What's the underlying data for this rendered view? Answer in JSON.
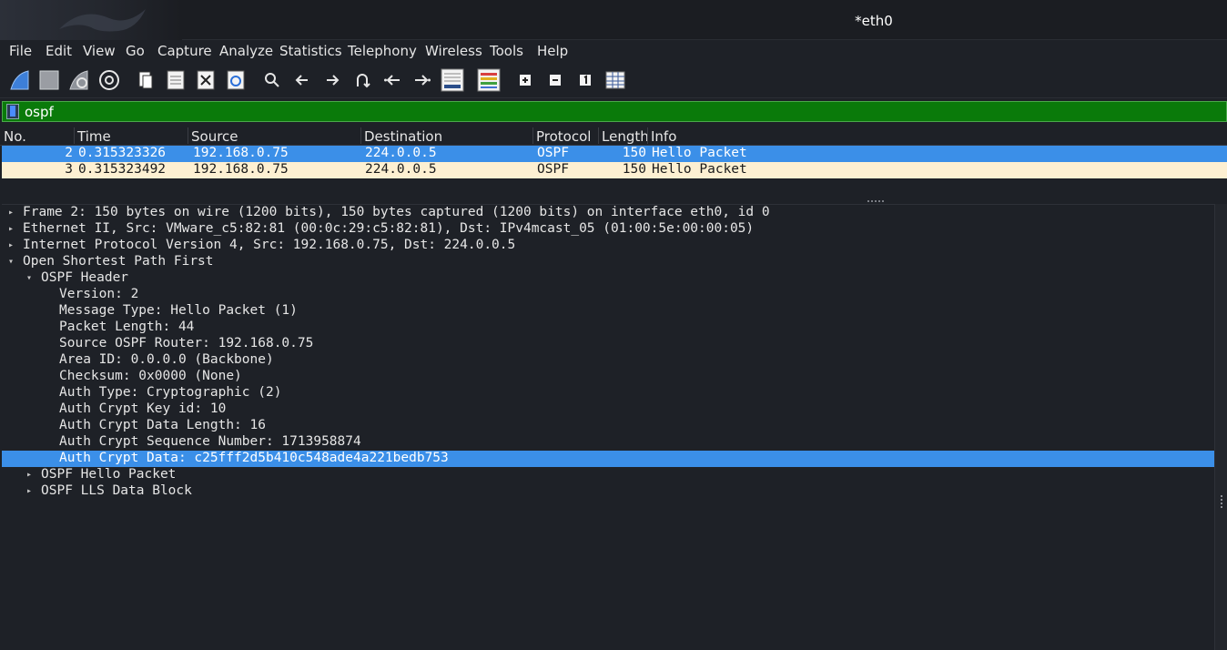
{
  "window": {
    "title": "*eth0"
  },
  "menu": [
    "File",
    "Edit",
    "View",
    "Go",
    "Capture",
    "Analyze",
    "Statistics",
    "Telephony",
    "Wireless",
    "Tools",
    "Help"
  ],
  "toolbar": {
    "icons": [
      "start-capture-icon",
      "stop-capture-icon",
      "restart-capture-icon",
      "capture-options-icon",
      "open-file-icon",
      "save-file-icon",
      "close-file-icon",
      "reload-file-icon",
      "find-packet-icon",
      "go-back-icon",
      "go-forward-icon",
      "go-to-packet-icon",
      "first-packet-icon",
      "last-packet-icon",
      "autoscroll-icon",
      "colorize-icon",
      "zoom-in-icon",
      "zoom-out-icon",
      "normal-size-icon",
      "resize-columns-icon"
    ]
  },
  "filter": {
    "value": "ospf"
  },
  "packet_list": {
    "columns": [
      "No.",
      "Time",
      "Source",
      "Destination",
      "Protocol",
      "Length",
      "Info"
    ],
    "rows": [
      {
        "no": "2",
        "time": "0.315323326",
        "source": "192.168.0.75",
        "destination": "224.0.0.5",
        "protocol": "OSPF",
        "length": "150",
        "info": "Hello Packet"
      },
      {
        "no": "3",
        "time": "0.315323492",
        "source": "192.168.0.75",
        "destination": "224.0.0.5",
        "protocol": "OSPF",
        "length": "150",
        "info": "Hello Packet"
      }
    ]
  },
  "details": {
    "lines": [
      "Frame 2: 150 bytes on wire (1200 bits), 150 bytes captured (1200 bits) on interface eth0, id 0",
      "Ethernet II, Src: VMware_c5:82:81 (00:0c:29:c5:82:81), Dst: IPv4mcast_05 (01:00:5e:00:00:05)",
      "Internet Protocol Version 4, Src: 192.168.0.75, Dst: 224.0.0.5",
      "Open Shortest Path First",
      "OSPF Header",
      "Version: 2",
      "Message Type: Hello Packet (1)",
      "Packet Length: 44",
      "Source OSPF Router: 192.168.0.75",
      "Area ID: 0.0.0.0 (Backbone)",
      "Checksum: 0x0000 (None)",
      "Auth Type: Cryptographic (2)",
      "Auth Crypt Key id: 10",
      "Auth Crypt Data Length: 16",
      "Auth Crypt Sequence Number: 1713958874",
      "Auth Crypt Data: c25fff2d5b410c548ade4a221bedb753",
      "OSPF Hello Packet",
      "OSPF LLS Data Block"
    ]
  },
  "colors": {
    "filter_bg": "#0a7a0a",
    "selection": "#3b8fe8",
    "alt_row": "#fdf0d2",
    "background": "#1e2127"
  }
}
